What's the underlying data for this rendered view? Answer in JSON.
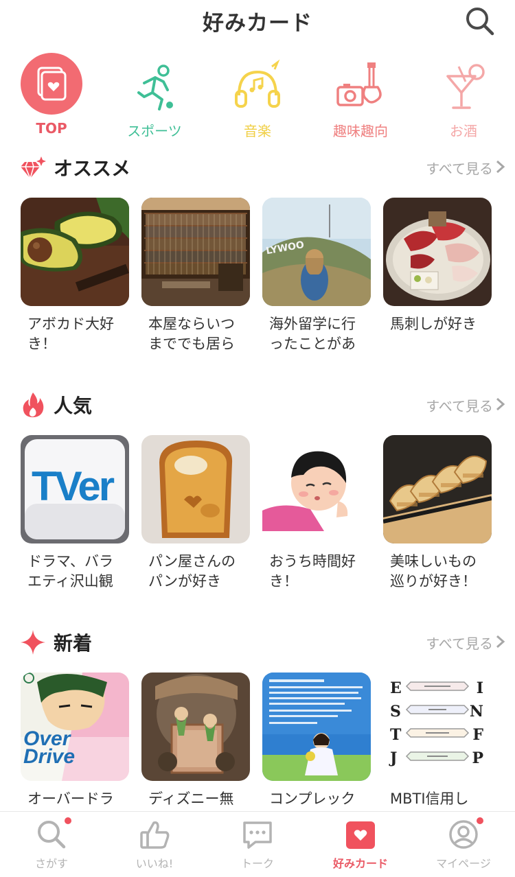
{
  "header": {
    "title": "好みカード"
  },
  "categories": [
    {
      "label": "TOP",
      "icon": "card-heart-icon",
      "color": "#ea5a66"
    },
    {
      "label": "スポーツ",
      "icon": "running-person-icon",
      "color": "#3fbf96"
    },
    {
      "label": "音楽",
      "icon": "headphones-icon",
      "color": "#f5d34c"
    },
    {
      "label": "趣味趣向",
      "icon": "camera-guitar-icon",
      "color": "#ef8080"
    },
    {
      "label": "お酒",
      "icon": "cocktail-icon",
      "color": "#f4a7a7"
    }
  ],
  "sections": {
    "recommend": {
      "title": "オススメ",
      "more": "すべて見る",
      "cards": [
        {
          "caption": "アボカド大好き！",
          "image": "avocado-photo"
        },
        {
          "caption": "本屋ならいつまででも居ら",
          "image": "bookstore-photo"
        },
        {
          "caption": "海外留学に行ったことがあ",
          "image": "hollywood-hill-photo"
        },
        {
          "caption": "馬刺しが好き",
          "image": "basashi-photo"
        }
      ]
    },
    "popular": {
      "title": "人気",
      "more": "すべて見る",
      "cards": [
        {
          "caption": "ドラマ、バラエティ沢山観",
          "image": "tver-logo",
          "logo_text": "TVer"
        },
        {
          "caption": "パン屋さんのパンが好き",
          "image": "toast-photo"
        },
        {
          "caption": "おうち時間好き！",
          "image": "relaxing-illustration"
        },
        {
          "caption": "美味しいもの巡りが好き！",
          "image": "gyoza-photo"
        }
      ]
    },
    "new": {
      "title": "新着",
      "more": "すべて見る",
      "cards": [
        {
          "caption": "オーバードラ",
          "image": "overdrive-manga-cover",
          "logo_text": "Over Drive"
        },
        {
          "caption": "ディズニー無",
          "image": "disney-fairy-photo"
        },
        {
          "caption": "コンプレック",
          "image": "complex-quote-poster"
        },
        {
          "caption": "MBTI信用し",
          "image": "mbti-chart",
          "letters": [
            "E",
            "I",
            "S",
            "N",
            "T",
            "F",
            "J",
            "P"
          ]
        }
      ]
    }
  },
  "tabbar": [
    {
      "label": "さがす",
      "icon": "search-icon",
      "badge": true,
      "active": false
    },
    {
      "label": "いいね!",
      "icon": "thumbs-up-icon",
      "badge": false,
      "active": false
    },
    {
      "label": "トーク",
      "icon": "chat-bubble-icon",
      "badge": false,
      "active": false
    },
    {
      "label": "好みカード",
      "icon": "card-heart-icon",
      "badge": false,
      "active": true
    },
    {
      "label": "マイページ",
      "icon": "profile-icon",
      "badge": true,
      "active": false
    }
  ],
  "colors": {
    "accent": "#ea5a66",
    "muted": "#a7a7a7",
    "badge": "#f0525e"
  }
}
